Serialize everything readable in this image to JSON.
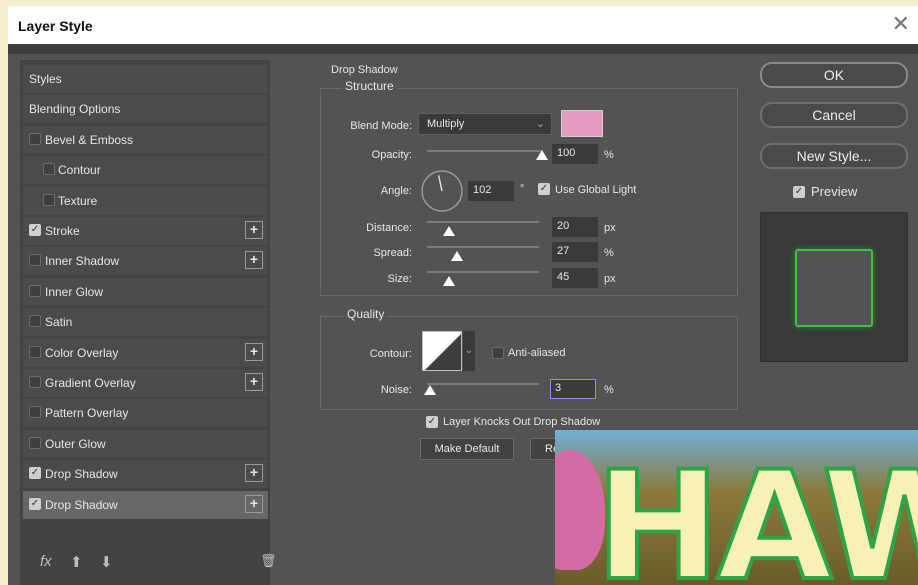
{
  "window": {
    "title": "Layer Style",
    "close_glyph": "✕"
  },
  "sidebar": {
    "items": [
      {
        "label": "Styles",
        "checkbox": false,
        "checked": false,
        "plus": false,
        "indent": 0
      },
      {
        "label": "Blending Options",
        "checkbox": false,
        "checked": false,
        "plus": false,
        "indent": 0
      },
      {
        "label": "Bevel & Emboss",
        "checkbox": true,
        "checked": false,
        "plus": false,
        "indent": 0
      },
      {
        "label": "Contour",
        "checkbox": true,
        "checked": false,
        "plus": false,
        "indent": 1
      },
      {
        "label": "Texture",
        "checkbox": true,
        "checked": false,
        "plus": false,
        "indent": 1
      },
      {
        "label": "Stroke",
        "checkbox": true,
        "checked": true,
        "plus": true,
        "indent": 0
      },
      {
        "label": "Inner Shadow",
        "checkbox": true,
        "checked": false,
        "plus": true,
        "indent": 0
      },
      {
        "label": "Inner Glow",
        "checkbox": true,
        "checked": false,
        "plus": false,
        "indent": 0
      },
      {
        "label": "Satin",
        "checkbox": true,
        "checked": false,
        "plus": false,
        "indent": 0
      },
      {
        "label": "Color Overlay",
        "checkbox": true,
        "checked": false,
        "plus": true,
        "indent": 0
      },
      {
        "label": "Gradient Overlay",
        "checkbox": true,
        "checked": false,
        "plus": true,
        "indent": 0
      },
      {
        "label": "Pattern Overlay",
        "checkbox": true,
        "checked": false,
        "plus": false,
        "indent": 0
      },
      {
        "label": "Outer Glow",
        "checkbox": true,
        "checked": false,
        "plus": false,
        "indent": 0
      },
      {
        "label": "Drop Shadow",
        "checkbox": true,
        "checked": true,
        "plus": true,
        "indent": 0
      },
      {
        "label": "Drop Shadow",
        "checkbox": true,
        "checked": true,
        "plus": true,
        "indent": 0,
        "selected": true
      }
    ],
    "footer": {
      "fx": "fx",
      "up": "⬆",
      "down": "⬇",
      "trash": "🗑"
    }
  },
  "drop_shadow": {
    "section_title": "Drop Shadow",
    "structure": {
      "title": "Structure",
      "blend_mode_label": "Blend Mode:",
      "blend_mode_value": "Multiply",
      "color_swatch": "#e39bc0",
      "opacity_label": "Opacity:",
      "opacity_value": "100",
      "opacity_unit": "%",
      "opacity_level": 1.0,
      "angle_label": "Angle:",
      "angle_value": "102",
      "angle_unit": "°",
      "use_global_light_label": "Use Global Light",
      "use_global_light_checked": true,
      "distance_label": "Distance:",
      "distance_value": "20",
      "distance_unit": "px",
      "distance_level": 0.2,
      "spread_label": "Spread:",
      "spread_value": "27",
      "spread_unit": "%",
      "spread_level": 0.27,
      "size_label": "Size:",
      "size_value": "45",
      "size_unit": "px",
      "size_level": 0.2
    },
    "quality": {
      "title": "Quality",
      "contour_label": "Contour:",
      "anti_aliased_label": "Anti-aliased",
      "anti_aliased_checked": false,
      "noise_label": "Noise:",
      "noise_value": "3",
      "noise_unit": "%",
      "noise_level": 0.03
    },
    "knocks_out_label": "Layer Knocks Out Drop Shadow",
    "knocks_out_checked": true,
    "make_default_label": "Make Default",
    "reset_default_label": "Res"
  },
  "actions": {
    "ok_label": "OK",
    "cancel_label": "Cancel",
    "new_style_label": "New Style...",
    "preview_label": "Preview",
    "preview_checked": true
  },
  "overlay_photo": {
    "text": "HAWA"
  },
  "colors": {
    "dialog_bg": "#535353",
    "stroke_green": "#3bc14a",
    "shadow_pink": "#e39bc0"
  }
}
